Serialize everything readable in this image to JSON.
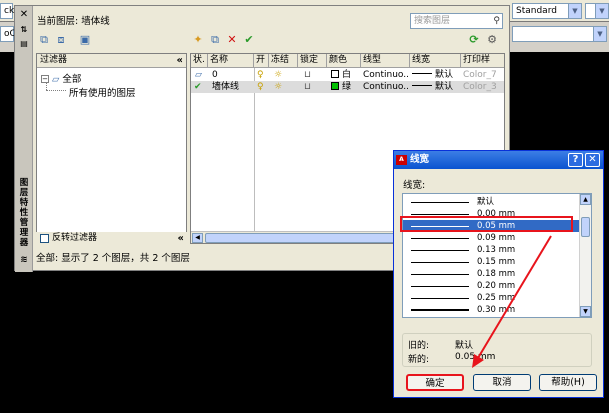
{
  "topbar": {
    "left_combo_value": "ck",
    "left_combo_value2": "oC",
    "right_combo_value": "Standard"
  },
  "palette": {
    "vertical_title": "图层特性管理器",
    "current_layer_label": "当前图层: 墙体线",
    "search_placeholder": "搜索图层",
    "filters_header": "过滤器",
    "tree_all": "全部",
    "tree_used": "所有使用的图层",
    "invert_filter_label": "反转过滤器",
    "status_text": "全部: 显示了 2 个图层，共 2 个图层",
    "columns": [
      "状.",
      "名称",
      "开",
      "冻结",
      "锁定",
      "颜色",
      "线型",
      "线宽",
      "打印样"
    ],
    "layers": [
      {
        "name": "0",
        "color_name": "白",
        "color": "#ffffff",
        "linetype": "Continuo...",
        "lineweight": "默认",
        "plotstyle": "Color_7"
      },
      {
        "name": "墙体线",
        "color_name": "绿",
        "color": "#00c000",
        "linetype": "Continuo...",
        "lineweight": "默认",
        "plotstyle": "Color_3"
      }
    ]
  },
  "dialog": {
    "title": "线宽",
    "list_label": "线宽:",
    "items": [
      {
        "label": "默认",
        "weight": 1
      },
      {
        "label": "0.00 mm",
        "weight": 1
      },
      {
        "label": "0.05 mm",
        "weight": 1,
        "selected": true
      },
      {
        "label": "0.09 mm",
        "weight": 1
      },
      {
        "label": "0.13 mm",
        "weight": 1
      },
      {
        "label": "0.15 mm",
        "weight": 1
      },
      {
        "label": "0.18 mm",
        "weight": 1
      },
      {
        "label": "0.20 mm",
        "weight": 1
      },
      {
        "label": "0.25 mm",
        "weight": 1
      },
      {
        "label": "0.30 mm",
        "weight": 2
      }
    ],
    "old_label": "旧的:",
    "old_value": "默认",
    "new_label": "新的:",
    "new_value": "0.05 mm",
    "ok_label": "确定",
    "cancel_label": "取消",
    "help_label": "帮助(H)"
  },
  "colors": {
    "highlight_red": "#e8141c",
    "selection_blue": "#316ac5",
    "title_blue": "#0a53d0"
  }
}
